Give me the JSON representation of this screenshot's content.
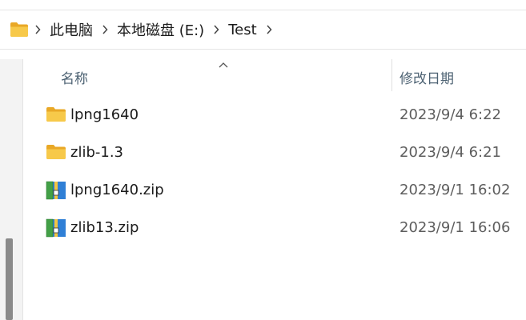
{
  "breadcrumb": {
    "icon": "folder-icon",
    "items": [
      {
        "label": "此电脑"
      },
      {
        "label": "本地磁盘 (E:)"
      },
      {
        "label": "Test"
      }
    ]
  },
  "columns": {
    "name": "名称",
    "date_modified": "修改日期",
    "sort": "ascending"
  },
  "files": [
    {
      "name": "lpng1640",
      "date": "2023/9/4 6:22",
      "type": "folder",
      "icon": "folder-icon"
    },
    {
      "name": "zlib-1.3",
      "date": "2023/9/4 6:21",
      "type": "folder",
      "icon": "folder-icon"
    },
    {
      "name": "lpng1640.zip",
      "date": "2023/9/1 16:02",
      "type": "zip",
      "icon": "zip-archive-icon"
    },
    {
      "name": "zlib13.zip",
      "date": "2023/9/1 16:06",
      "type": "zip",
      "icon": "zip-archive-icon"
    }
  ],
  "colors": {
    "folder": "#f7c94a",
    "folder_dark": "#e9a826",
    "zip_blue": "#2f7fd6",
    "zip_green": "#43a047",
    "header_text": "#4d6273"
  }
}
